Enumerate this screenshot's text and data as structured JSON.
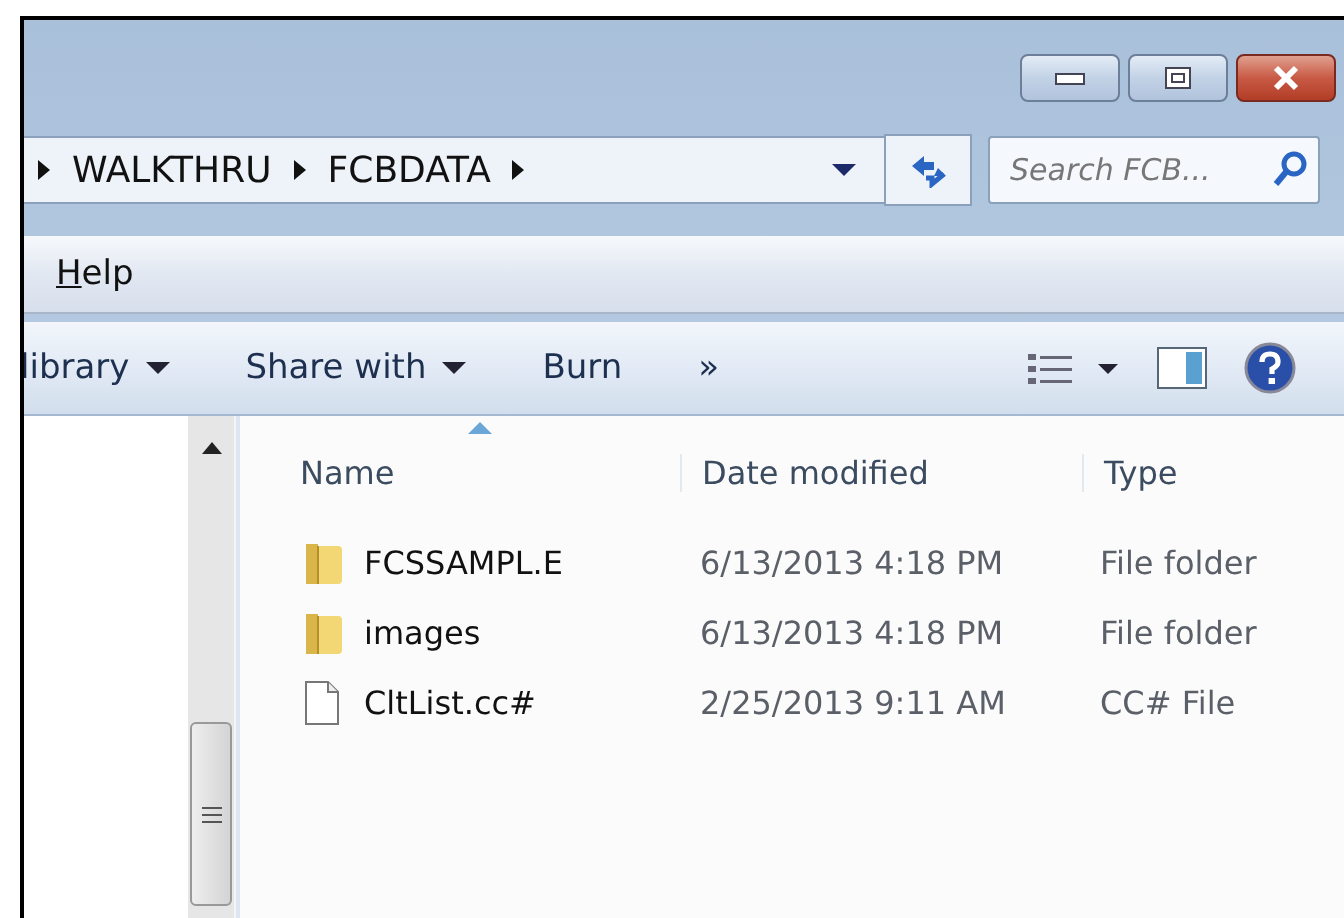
{
  "address_bar": {
    "path": [
      "WALKTHRU",
      "FCBDATA"
    ]
  },
  "search": {
    "placeholder": "Search FCB..."
  },
  "menu_bar": [
    {
      "label": "Help"
    }
  ],
  "toolbar": [
    {
      "kind": "dropdown",
      "label": "library"
    },
    {
      "kind": "dropdown",
      "label": "Share with"
    },
    {
      "kind": "plain",
      "label": "Burn"
    },
    {
      "kind": "plain",
      "label": "»"
    }
  ],
  "columns": [
    {
      "label": "Name",
      "sorted": true
    },
    {
      "label": "Date modified",
      "sorted": false
    },
    {
      "label": "Type",
      "sorted": false
    }
  ],
  "rows": [
    {
      "kind": "folder",
      "name": "FCSSAMPL.E",
      "date": "6/13/2013 4:18 PM",
      "type": "File folder"
    },
    {
      "kind": "folder",
      "name": "images",
      "date": "6/13/2013 4:18 PM",
      "type": "File folder"
    },
    {
      "kind": "file",
      "name": "CltList.cc#",
      "date": "2/25/2013 9:11 AM",
      "type": "CC# File"
    }
  ]
}
